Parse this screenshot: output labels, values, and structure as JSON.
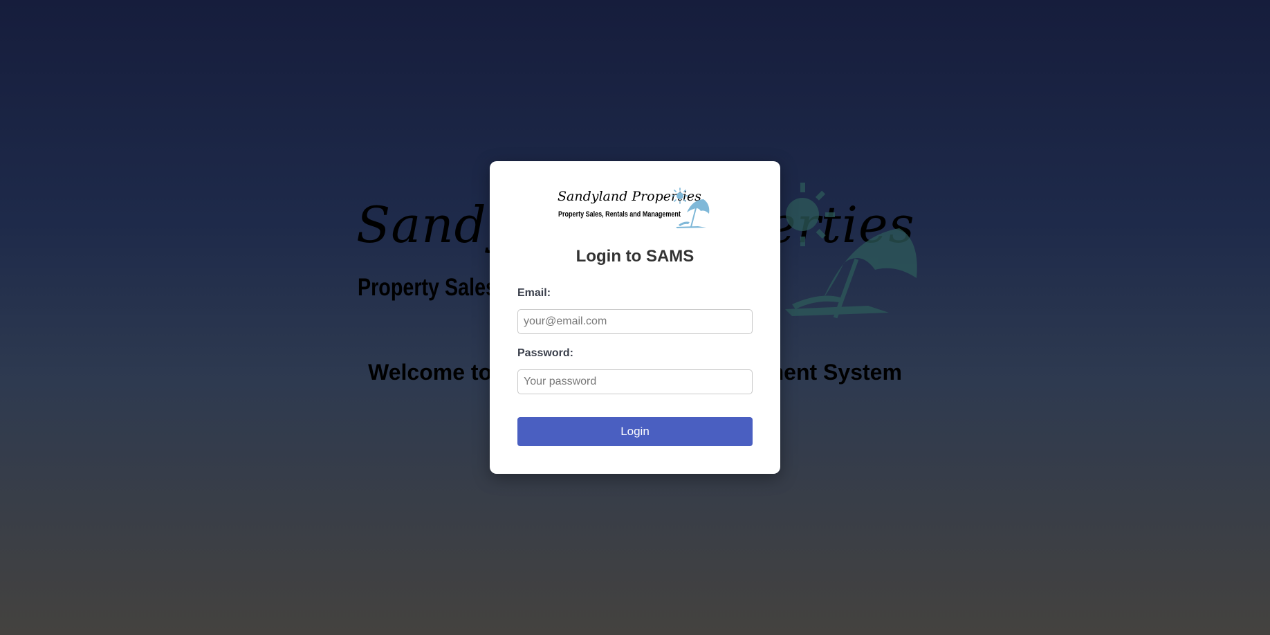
{
  "background": {
    "brand_name": "Sandyland Properties",
    "tagline": "Property Sales, Rentals and Management",
    "welcome": "Welcome to Sandyland Asset Management System"
  },
  "logo": {
    "name": "Sandyland Properties",
    "subtitle": "Property Sales, Rentals and Management",
    "icon": "beach-umbrella-sun-icon",
    "color": "#7fb8d8"
  },
  "login": {
    "title": "Login to SAMS",
    "email_label": "Email:",
    "email_placeholder": "your@email.com",
    "email_value": "",
    "password_label": "Password:",
    "password_placeholder": "Your password",
    "password_value": "",
    "submit_label": "Login"
  },
  "colors": {
    "accent": "#4a5fc1",
    "card": "#ffffff",
    "bg_top": "#161d3c",
    "bg_bottom": "#44423f"
  }
}
